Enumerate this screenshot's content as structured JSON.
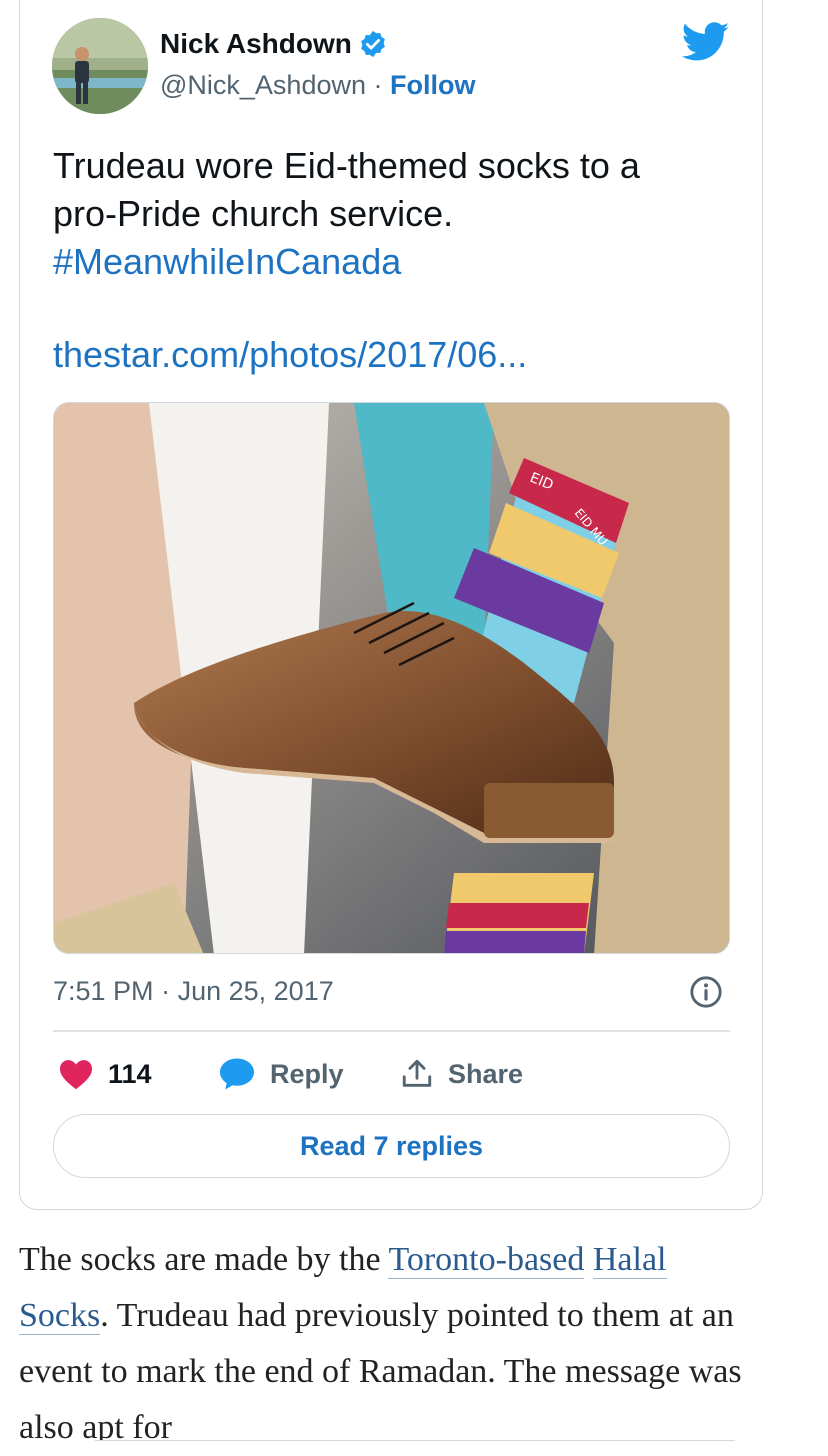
{
  "tweet": {
    "author_name": "Nick Ashdown",
    "handle": "@Nick_Ashdown",
    "separator": "·",
    "follow_label": "Follow",
    "text_line1": "Trudeau wore Eid-themed socks to a",
    "text_line2": "pro-Pride church service.",
    "hashtag": "#MeanwhileInCanada",
    "link": "thestar.com/photos/2017/06...",
    "sock_text_1": "EID",
    "sock_text_2": "EID MU",
    "time": "7:51 PM",
    "date": "Jun 25, 2017",
    "likes_count": "114",
    "reply_label": "Reply",
    "share_label": "Share",
    "read_replies_label": "Read 7 replies"
  },
  "article": {
    "text_before": "The socks are made by the ",
    "link1": "Toronto-based",
    "space": " ",
    "link2": "Halal Socks",
    "text_after": ". Trudeau had previously pointed to them at an event to mark the end of Ramadan. The message was also apt for"
  },
  "colors": {
    "link_blue": "#1d72c2",
    "like_pink": "#e0245e",
    "verified_blue": "#1d9bf0",
    "twitter_blue": "#1d9bf0"
  }
}
